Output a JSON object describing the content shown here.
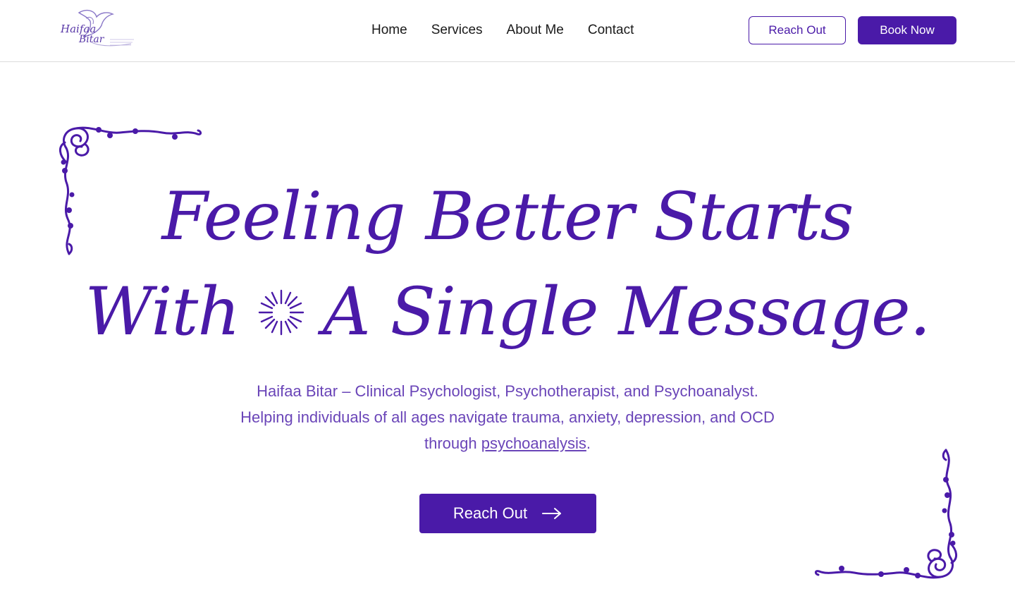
{
  "header": {
    "logo": {
      "line1": "Haifaa",
      "line2": "Bitar",
      "icon": "dove-logo-icon"
    },
    "nav": [
      {
        "label": "Home"
      },
      {
        "label": "Services"
      },
      {
        "label": "About Me"
      },
      {
        "label": "Contact"
      }
    ],
    "reach_out_label": "Reach Out",
    "book_now_label": "Book Now"
  },
  "hero": {
    "title_line1": "Feeling Better Starts",
    "title_line2_a": "With",
    "title_line2_b": "A Single Message.",
    "sparkle_icon": "sparkle-icon",
    "subtitle_line1": "Haifaa Bitar – Clinical Psychologist, Psychotherapist, and Psychoanalyst.",
    "subtitle_line2": "Helping individuals of all ages navigate trauma, anxiety, depression, and OCD",
    "subtitle_line3_prefix": "through ",
    "subtitle_link": "psychoanalysis",
    "subtitle_line3_suffix": ".",
    "cta_label": "Reach Out",
    "cta_icon": "arrow-right-icon"
  },
  "colors": {
    "primary": "#4a1aa8",
    "subtitle": "#6a45b8",
    "border": "#dcdcdc"
  }
}
